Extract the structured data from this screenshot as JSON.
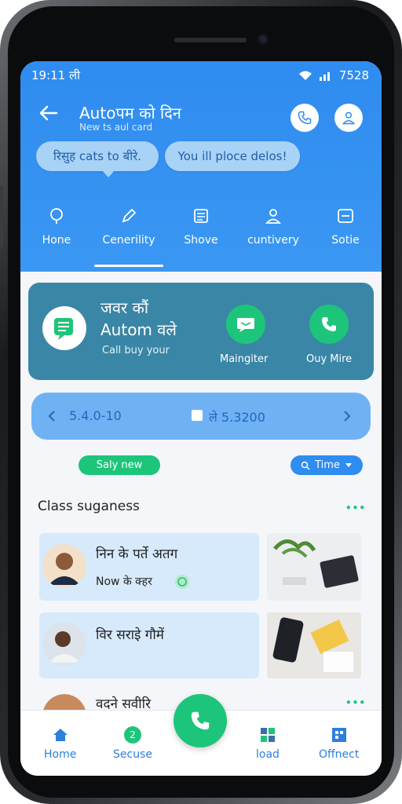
{
  "status": {
    "time": "19:11 ली",
    "right": "7528"
  },
  "header": {
    "title": "Autoपम को दिन",
    "subtitle": "New ts aul card",
    "bubble_left": "रिसुह cats to बीरे.",
    "bubble_right": "You ill ploce delos!"
  },
  "tabs": [
    {
      "label": "Hone",
      "icon": "pin-icon"
    },
    {
      "label": "Cenerility",
      "icon": "pencil-icon"
    },
    {
      "label": "Shove",
      "icon": "list-icon"
    },
    {
      "label": "cuntivery",
      "icon": "user-icon"
    },
    {
      "label": "Sotie",
      "icon": "minus-box-icon"
    }
  ],
  "call_card": {
    "line1": "जवर कौं",
    "line2": "Autom वले",
    "line3": "Call buy your",
    "button1_label": "Maingiter",
    "button2_label": "Ouy Mire"
  },
  "range": {
    "left_value": "5.4.0-10",
    "right_value": "ले 5.3200"
  },
  "chips": {
    "left": "Saly new",
    "right": "Time"
  },
  "section_title": "Class suganess",
  "rows": [
    {
      "title": "निन के पर्ते अतग",
      "sub": "Now के क्हर"
    },
    {
      "title": "विर सराइे गौमें",
      "sub": ""
    },
    {
      "title": "वदने सवीरि",
      "sub": ""
    }
  ],
  "bottom_nav": [
    {
      "label": "Home",
      "icon": "home-icon"
    },
    {
      "label": "Secuse",
      "icon": "badge-icon",
      "badge": "2"
    },
    {
      "label": "load",
      "icon": "grid-icon"
    },
    {
      "label": "Offnect",
      "icon": "apps-icon"
    }
  ],
  "colors": {
    "primary_blue": "#2f8cf0",
    "green": "#1dc57a",
    "teal_card": "#3a86a6"
  }
}
